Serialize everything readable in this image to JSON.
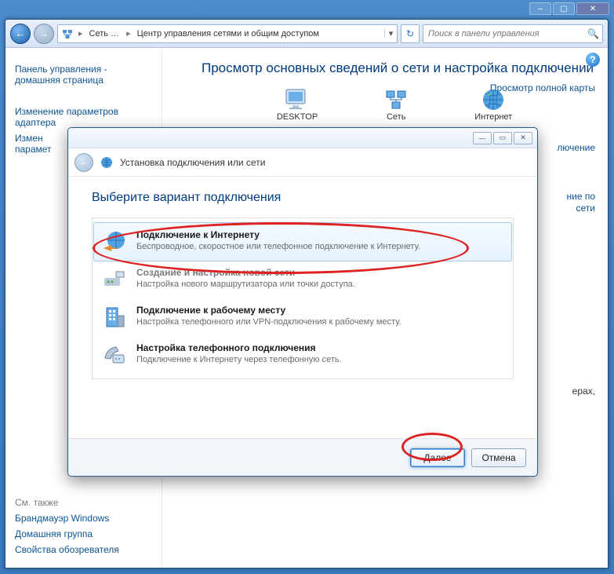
{
  "window": {
    "min_btn": "–",
    "max_btn": "▢",
    "close_btn": "✕"
  },
  "explorer": {
    "nav_back": "←",
    "nav_fwd": "→",
    "crumb_root": "Сеть …",
    "crumb_page": "Центр управления сетями и общим доступом",
    "crumb_sep": "▸",
    "addr_drop": "▾",
    "refresh": "↻",
    "search_placeholder": "Поиск в панели управления",
    "search_icon": "🔍",
    "help_icon": "?"
  },
  "sidebar": {
    "cp_home": "Панель управления - домашняя страница",
    "link_adapter": "Изменение параметров адаптера",
    "link_share_prefix": "Измен",
    "link_share_suffix": "парамет",
    "see_also": "См. также",
    "link_firewall": "Брандмауэр Windows",
    "link_homegroup": "Домашняя группа",
    "link_ie": "Свойства обозревателя"
  },
  "content": {
    "page_title": "Просмотр основных сведений о сети и настройка подключений",
    "right_link_map": "Просмотр полной карты",
    "node1": "DESKTOP",
    "node2": "Сеть",
    "node3": "Интернет",
    "frag_right1": "лючение",
    "frag_right2": "ние по",
    "frag_right3": "сети",
    "frag_right4": "ерах,"
  },
  "wizard": {
    "title_min": "—",
    "title_max": "▭",
    "title_close": "✕",
    "back": "←",
    "header_title": "Установка подключения или сети",
    "heading": "Выберите вариант подключения",
    "options": [
      {
        "title": "Подключение к Интернету",
        "desc": "Беспроводное, скоростное или телефонное подключение к Интернету."
      },
      {
        "title": "Создание и настройка новой сети",
        "desc": "Настройка нового маршрутизатора или точки доступа."
      },
      {
        "title": "Подключение к рабочему месту",
        "desc": "Настройка телефонного или VPN-подключения к рабочему месту."
      },
      {
        "title": "Настройка телефонного подключения",
        "desc": "Подключение к Интернету через телефонную сеть."
      }
    ],
    "btn_next": "Далее",
    "btn_cancel": "Отмена"
  }
}
